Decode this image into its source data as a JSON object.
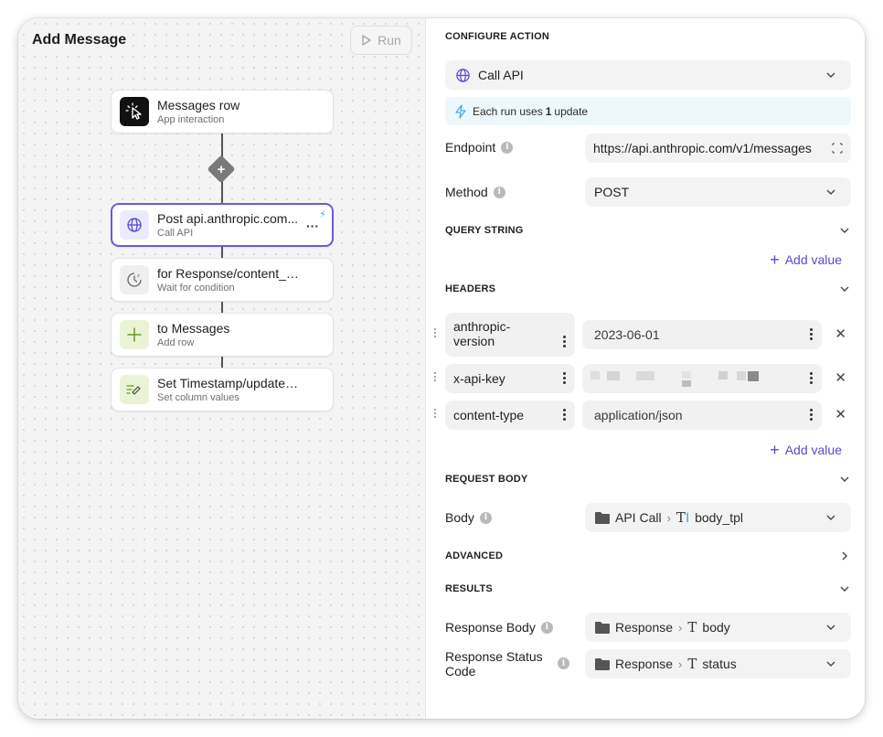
{
  "left": {
    "title": "Add Message",
    "run_label": "Run",
    "nodes": [
      {
        "title": "Messages row",
        "subtitle": "App interaction"
      },
      {
        "title": "Post api.anthropic.com...",
        "subtitle": "Call API",
        "more": "···",
        "bolt": "⚡"
      },
      {
        "title": "for Response/content_text",
        "subtitle": "Wait for condition"
      },
      {
        "title": "to Messages",
        "subtitle": "Add row"
      },
      {
        "title": "Set Timestamp/updated in ...",
        "subtitle": "Set column values"
      }
    ]
  },
  "right": {
    "configure_action": "CONFIGURE ACTION",
    "action_value": "Call API",
    "update_note_pre": "Each run uses ",
    "update_note_num": "1",
    "update_note_post": " update",
    "endpoint_label": "Endpoint",
    "endpoint_value": "https://api.anthropic.com/v1/messages",
    "method_label": "Method",
    "method_value": "POST",
    "query_string": "QUERY STRING",
    "add_value": "Add value",
    "headers_title": "HEADERS",
    "headers": [
      {
        "key": "anthropic-version",
        "value": "2023-06-01"
      },
      {
        "key": "x-api-key",
        "value": ""
      },
      {
        "key": "content-type",
        "value": "application/json"
      }
    ],
    "request_body": "REQUEST BODY",
    "body_label": "Body",
    "body_path": {
      "folder": "API Call",
      "field": "body_tpl"
    },
    "advanced": "ADVANCED",
    "results": "RESULTS",
    "response_body_label": "Response Body",
    "response_body_path": {
      "folder": "Response",
      "field": "body"
    },
    "response_status_label": "Response Status Code",
    "response_status_path": {
      "folder": "Response",
      "field": "status"
    }
  },
  "colors": {
    "accent": "#5a47d6",
    "selected_border": "#6e57e0",
    "info_bg": "#eef8fc"
  }
}
